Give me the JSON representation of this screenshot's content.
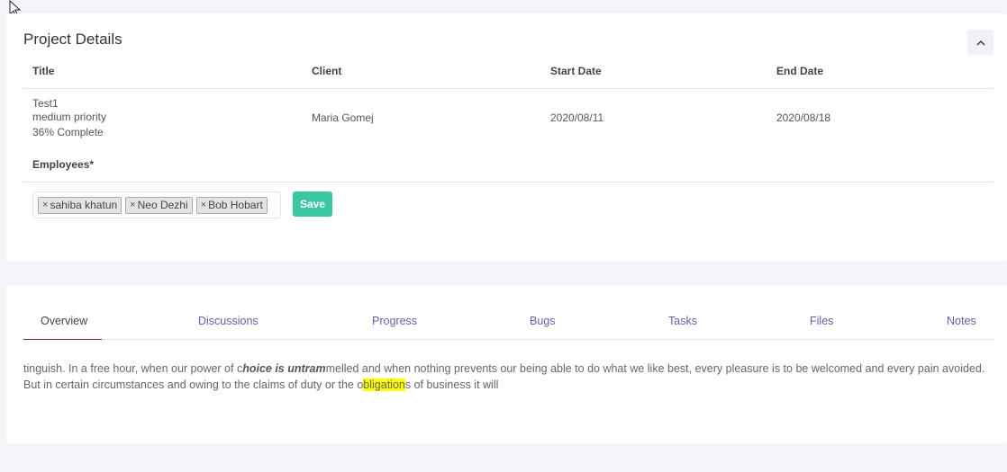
{
  "project": {
    "heading": "Project Details",
    "columns": {
      "title": "Title",
      "client": "Client",
      "start": "Start Date",
      "end": "End Date"
    },
    "row": {
      "title": "Test1",
      "priority": "medium priority",
      "progress": "36% Complete",
      "client": "Maria Gomej",
      "start": "2020/08/11",
      "end": "2020/08/18"
    },
    "employees_label": "Employees*",
    "employees": [
      "sahiba khatun",
      "Neo Dezhi",
      "Bob Hobart"
    ],
    "remove_glyph": "×",
    "save_label": "Save"
  },
  "tabs": [
    "Overview",
    "Discussions",
    "Progress",
    "Bugs",
    "Tasks",
    "Files",
    "Notes"
  ],
  "overview": {
    "part1": "tinguish. In a free hour, when our power of c",
    "bold_italic": "hoice is untram",
    "part2": "melled and when nothing prevents our being able to do what we like best, every pleasure is to be welcomed and every pain avoided. But in certain circumstances and owing to the claims of duty or the o",
    "highlight": "bligation",
    "part3": "s of business it will"
  },
  "colors": {
    "accent": "#3cc7a3",
    "tab_text": "#6d5ba8",
    "tab_active_underline": "#8b1d2c",
    "highlight": "#ffff00"
  }
}
